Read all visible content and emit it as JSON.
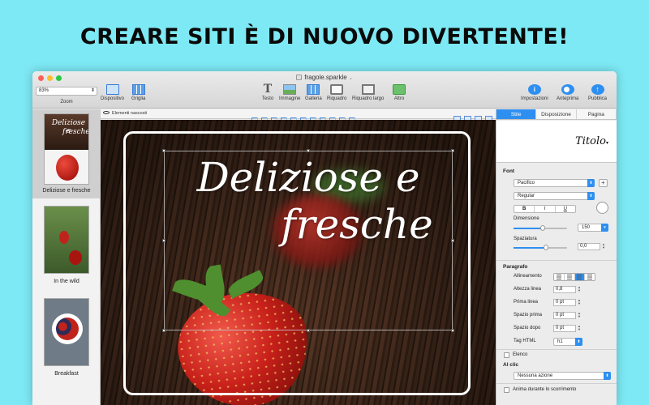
{
  "headline": "CREARE SITI È DI NUOVO DIVERTENTE!",
  "window": {
    "title": "fragole.sparkle"
  },
  "toolbar": {
    "zoom_value": "83%",
    "zoom_label": "Zoom",
    "device": "Dispositivo",
    "grid": "Griglia",
    "text": "Testo",
    "image": "Immagine",
    "gallery": "Galleria",
    "box": "Riquadro",
    "wide_box": "Riquadro largo",
    "more": "Altro",
    "settings": "Impostazioni",
    "preview": "Anteprima",
    "publish": "Pubblica"
  },
  "pages": [
    {
      "label": "Deliziose e fresche",
      "selected": true
    },
    {
      "label": "In the wild",
      "selected": false
    },
    {
      "label": "Breakfast",
      "selected": false
    }
  ],
  "canvas": {
    "hidden_elements": "Elementi nascosti",
    "hero_line1": "Deliziose e",
    "hero_line2": "fresche"
  },
  "inspector": {
    "tabs": [
      "Stile",
      "Disposizione",
      "Pagina"
    ],
    "active_tab": "Stile",
    "style_sample": "Titolo",
    "font_section": "Font",
    "font_family": "Pacifico",
    "font_weight": "Regular",
    "bold": "B",
    "italic": "I",
    "underline": "U",
    "size_label": "Dimensione",
    "size_value": "150",
    "spacing_label": "Spaziatura",
    "spacing_value": "0,0",
    "paragraph_section": "Paragrafo",
    "alignment_label": "Allineamento",
    "line_height_label": "Altezza linea",
    "line_height_value": "0,8",
    "first_line_label": "Prima linea",
    "first_line_value": "0 pt",
    "space_before_label": "Spazio prima",
    "space_before_value": "0 pt",
    "space_after_label": "Spazio dopo",
    "space_after_value": "0 pt",
    "html_tag_label": "Tag HTML",
    "html_tag_value": "h1",
    "list_label": "Elenco",
    "on_click_section": "Al clic",
    "on_click_value": "Nessuna azione",
    "animate_label": "Anima durante lo scorrimento"
  },
  "colors": {
    "background": "#7de9f4",
    "accent": "#2e8ff0"
  }
}
